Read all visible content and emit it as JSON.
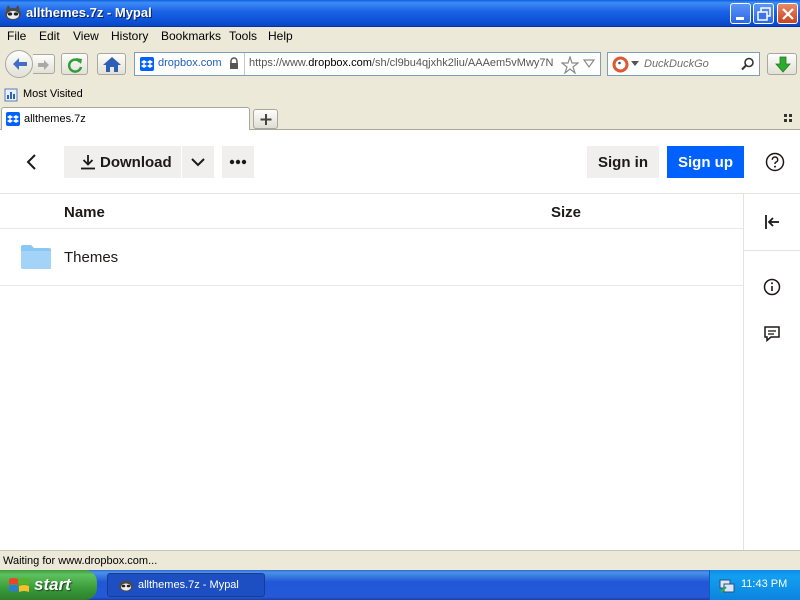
{
  "window": {
    "title": "allthemes.7z - Mypal"
  },
  "menu": {
    "file": "File",
    "edit": "Edit",
    "view": "View",
    "history": "History",
    "bookmarks": "Bookmarks",
    "tools": "Tools",
    "help": "Help"
  },
  "nav": {
    "identity_label": "dropbox.com",
    "url_prefix": "https://www.",
    "url_host": "dropbox.com",
    "url_path": "/sh/cl9bu4qjxhk2liu/AAAem5vMwy7N",
    "search_placeholder": "DuckDuckGo"
  },
  "bookmarks": {
    "most_visited": "Most Visited"
  },
  "tabs": {
    "active_title": "allthemes.7z"
  },
  "page": {
    "download_label": "Download",
    "signin_label": "Sign in",
    "signup_label": "Sign up",
    "columns": {
      "name": "Name",
      "size": "Size"
    },
    "files": [
      {
        "name": "Themes",
        "type": "folder-icon"
      }
    ]
  },
  "status": {
    "text": "Waiting for www.dropbox.com..."
  },
  "taskbar": {
    "start_label": "start",
    "task_label": "allthemes.7z - Mypal",
    "clock": "11:43 PM"
  },
  "colors": {
    "accent": "#0061FE",
    "folder": "#8AC7F2",
    "title_bar": "#0B4FD3"
  }
}
